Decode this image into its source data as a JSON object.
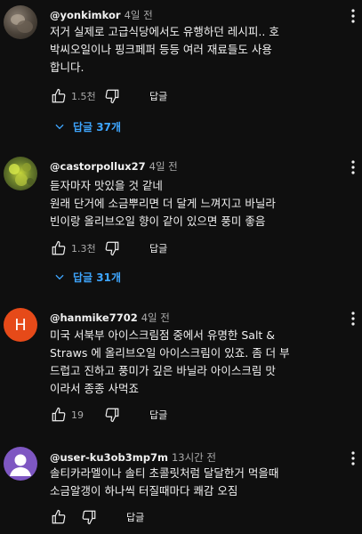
{
  "comments": [
    {
      "author": "@yonkimkor",
      "time": "4일 전",
      "lines": [
        "저거 실제로 고급식당에서도 유행하던 레시피.. 호",
        "박씨오일이나 핑크페퍼 등등 여러 재료들도 사용",
        "합니다."
      ],
      "likes": "1.5천",
      "reply_label": "답글",
      "replies_label": "답글 37개",
      "avatar_icon": "profile-photo"
    },
    {
      "author": "@castorpollux27",
      "time": "4일 전",
      "lines": [
        "듣자마자 맛있을 것 같네",
        "원래 단거에 소금뿌리면 더 달게 느껴지고 바닐라",
        "빈이랑 올리브오일 향이 같이 있으면 풍미 좋음"
      ],
      "likes": "1.3천",
      "reply_label": "답글",
      "replies_label": "답글 31개",
      "avatar_icon": "profile-photo"
    },
    {
      "author": "@hanmike7702",
      "time": "4일 전",
      "lines": [
        "미국 서북부 아이스크림점 중에서 유명한 Salt &",
        "Straws 에 올리브오일 아이스크림이 있죠. 좀 더 부",
        "드럽고 진하고 풍미가 깊은 바닐라 아이스크림 맛",
        "이라서 종종 사먹죠"
      ],
      "likes": "19",
      "reply_label": "답글",
      "avatar_letter": "H",
      "avatar_color": "#e64a19"
    },
    {
      "author": "@user-ku3ob3mp7m",
      "time": "13시간 전",
      "lines": [
        "솔티카라멜이나 솔티 초콜릿처럼 달달한거 먹을때",
        "소금알갱이 하나씩 터질때마다 쾌감 오짐"
      ],
      "likes": "",
      "reply_label": "답글",
      "avatar_color": "#7e57c2"
    }
  ],
  "colors": {
    "background": "#0f0f0f",
    "text": "#f1f1f1",
    "muted": "#aaaaaa",
    "link": "#3ea6ff"
  }
}
